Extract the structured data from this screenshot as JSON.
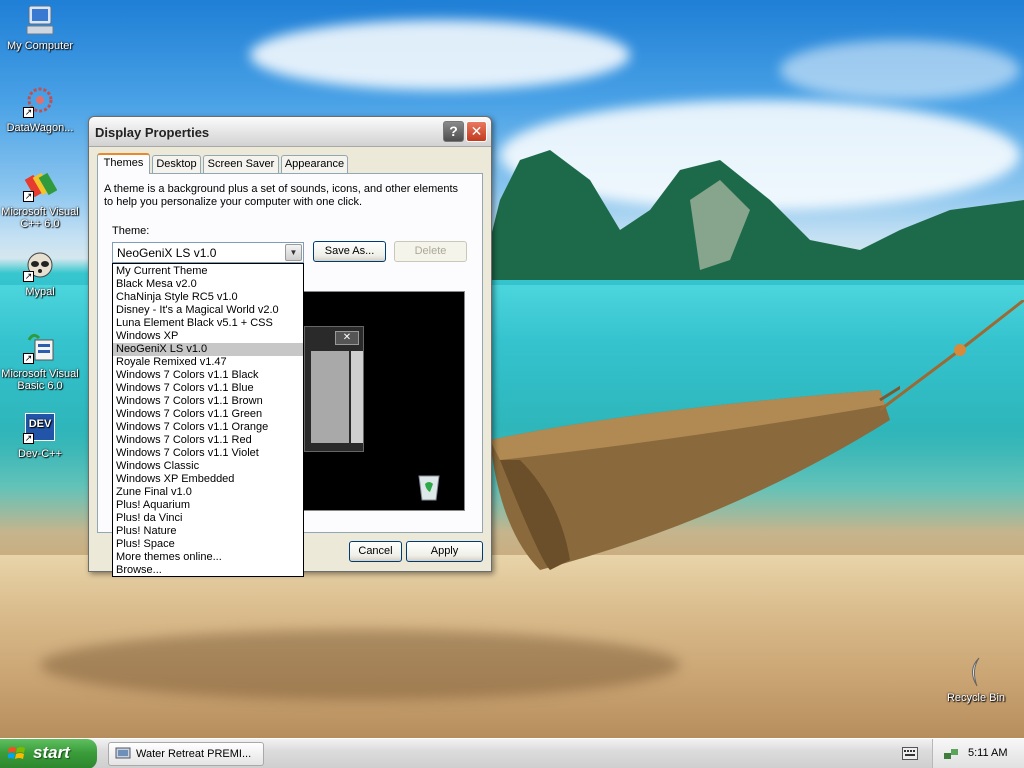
{
  "desktop": {
    "icons": [
      {
        "label": "My Computer",
        "icon": "my-computer-icon"
      },
      {
        "label": "DataWagon...",
        "icon": "datawagon-icon"
      },
      {
        "label": "Microsoft Visual C++ 6.0",
        "icon": "visual-cpp-icon"
      },
      {
        "label": "Mypal",
        "icon": "mypal-icon"
      },
      {
        "label": "Microsoft Visual Basic 6.0",
        "icon": "visual-basic-icon"
      },
      {
        "label": "Dev-C++",
        "icon": "devcpp-icon"
      },
      {
        "label": "Recycle Bin",
        "icon": "recycle-bin-icon"
      }
    ],
    "devcpp_badge": "DEV"
  },
  "dialog": {
    "title": "Display Properties",
    "help_glyph": "?",
    "close_glyph": "✕",
    "tabs": [
      {
        "label": "Themes",
        "active": true
      },
      {
        "label": "Desktop",
        "active": false
      },
      {
        "label": "Screen Saver",
        "active": false
      },
      {
        "label": "Appearance",
        "active": false
      }
    ],
    "description": "A theme is a background plus a set of sounds, icons, and other elements to help you personalize your computer with one click.",
    "theme_label": "Theme:",
    "theme_value": "NeoGeniX LS v1.0",
    "save_as_label": "Save As...",
    "delete_label": "Delete",
    "cancel_label": "Cancel",
    "apply_label": "Apply",
    "preview_close_glyph": "✕",
    "theme_options": [
      "My Current Theme",
      "Black Mesa v2.0",
      "ChaNinja Style RC5 v1.0",
      "Disney - It's a Magical World v2.0",
      "Luna Element Black v5.1 + CSS",
      "Windows XP",
      "NeoGeniX LS v1.0",
      "Royale Remixed v1.47",
      "Windows 7 Colors v1.1 Black",
      "Windows 7 Colors v1.1 Blue",
      "Windows 7 Colors v1.1 Brown",
      "Windows 7 Colors v1.1 Green",
      "Windows 7 Colors v1.1 Orange",
      "Windows 7 Colors v1.1 Red",
      "Windows 7 Colors v1.1 Violet",
      "Windows Classic",
      "Windows XP Embedded",
      "Zune Final v1.0",
      "Plus! Aquarium",
      "Plus! da Vinci",
      "Plus! Nature",
      "Plus! Space",
      "More themes online...",
      "Browse..."
    ],
    "selected_index": 6
  },
  "taskbar": {
    "start_label": "start",
    "task_label": "Water Retreat PREMI...",
    "clock": "5:11 AM"
  },
  "colors": {
    "accent_tab": "#e68b2c",
    "start_green": "#3a9d3a",
    "close_red": "#c23a1d",
    "dropdown_selected": "#c7c7c7"
  }
}
